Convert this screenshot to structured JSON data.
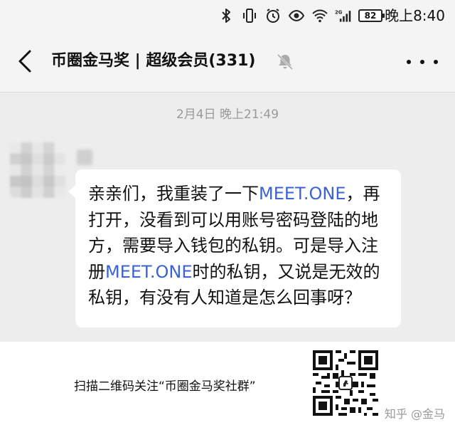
{
  "status_bar": {
    "battery": "82",
    "time": "晚上8:40",
    "network": "2G",
    "icons": [
      "bluetooth-icon",
      "vibrate-icon",
      "alarm-icon",
      "eye-icon",
      "wifi-icon",
      "signal-icon",
      "battery-icon"
    ]
  },
  "nav": {
    "title": "币圈金马奖 | 超级会员(331)",
    "back_icon": "chevron-left-icon",
    "mute_icon": "bell-off-icon",
    "more_icon": "more-dots-icon"
  },
  "chat": {
    "timestamp": "2月4日 晚上21:49",
    "message": {
      "l1_a": "亲亲们，我重装了一下",
      "l1_hl": "MEET.ONE",
      "l1_b": "，再",
      "l2": "打开，没看到可以用账号密码登陆的地",
      "l3": "方，需要导入钱包的私钥。可是导入注",
      "l4_a": "册",
      "l4_hl": "MEET.ONE",
      "l4_b": "时的私钥，又说是无效的",
      "l5": "私钥，有没有人知道是怎么回事呀？"
    }
  },
  "footer": {
    "scan_text": "扫描二维码关注“币圈金马奖社群”",
    "watermark": "知乎 @金马"
  },
  "colors": {
    "link": "#3b63d6",
    "chat_background": "#ededed",
    "bubble": "#ffffff",
    "timestamp": "#9a9a9a"
  }
}
